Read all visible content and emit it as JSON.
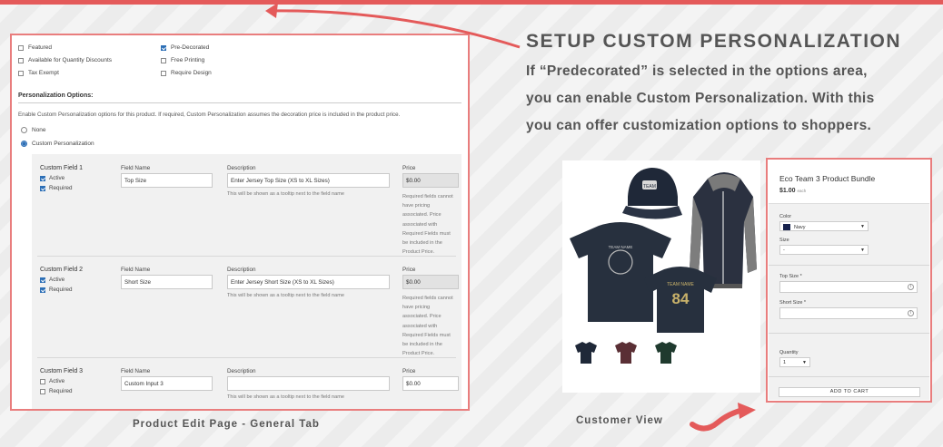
{
  "headline": {
    "title": "SETUP CUSTOM PERSONALIZATION",
    "lines": [
      "If “Predecorated” is selected in the options area,",
      "you can enable Custom Personalization. With this",
      "you can offer customization options to shoppers."
    ]
  },
  "admin": {
    "checkboxes": [
      {
        "label": "Featured",
        "checked": false
      },
      {
        "label": "Available for Quantity Discounts",
        "checked": false
      },
      {
        "label": "Tax Exempt",
        "checked": false
      },
      {
        "label": "Pre-Decorated",
        "checked": true
      },
      {
        "label": "Free Printing",
        "checked": false
      },
      {
        "label": "Require Design",
        "checked": false
      }
    ],
    "section_title": "Personalization Options:",
    "section_desc": "Enable Custom Personalization options for this product. If required, Custom Personalization assumes the decoration price is included in the product price.",
    "radio_none": "None",
    "radio_custom": "Custom Personalization",
    "col_field_name": "Field Name",
    "col_description": "Description",
    "col_price": "Price",
    "active_label": "Active",
    "required_label": "Required",
    "tooltip_hint": "This will be shown as a tooltip next to the field name",
    "price_note_lines": [
      "Required fields cannot",
      "have pricing",
      "associated. Price",
      "associated with",
      "Required Fields must",
      "be included in the",
      "Product Price."
    ],
    "custom_fields": [
      {
        "title": "Custom Field 1",
        "active": true,
        "required": true,
        "name": "Top Size",
        "description": "Enter Jersey Top Size (XS to XL Sizes)",
        "price": "$0.00"
      },
      {
        "title": "Custom Field 2",
        "active": true,
        "required": true,
        "name": "Short Size",
        "description": "Enter Jersey Short Size (XS to XL Sizes)",
        "price": "$0.00"
      },
      {
        "title": "Custom Field 3",
        "active": false,
        "required": false,
        "name": "Custom Input 3",
        "description": "",
        "price": "$0.00"
      }
    ]
  },
  "customer": {
    "product_name": "Eco Team 3 Product Bundle",
    "price": "$1.00",
    "price_unit": "each",
    "color_label": "Color",
    "color_value": "Navy",
    "size_label": "Size",
    "size_value": "-",
    "top_size_label": "Top Size *",
    "short_size_label": "Short Size *",
    "quantity_label": "Quantity",
    "quantity_value": "1",
    "add_to_cart": "ADD TO CART"
  },
  "photo": {
    "cap_patch": "TEAM",
    "shirt_text": "TEAM NAME",
    "jersey_name": "TEAM NAME",
    "jersey_number": "84"
  },
  "captions": {
    "admin": "Product Edit Page - General Tab",
    "customer": "Customer View"
  },
  "colors": {
    "accent": "#e45a5a",
    "panel_border": "#e97d7d",
    "check_blue": "#2d6fb6",
    "navy": "#17224d"
  }
}
